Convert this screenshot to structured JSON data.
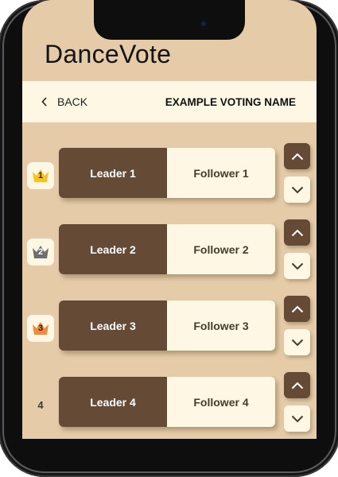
{
  "app": {
    "title": "DanceVote"
  },
  "header": {
    "back_label": "BACK",
    "voting_name": "EXAMPLE VOTING NAME"
  },
  "colors": {
    "background": "#e5cba7",
    "leader_bg": "#654a36",
    "follower_bg": "#fdf7e4",
    "gold": "#f6c22a",
    "silver": "#6e6e6e",
    "bronze": "#f08a3c"
  },
  "rows": [
    {
      "rank": "1",
      "medal": "gold-crown-icon",
      "leader": "Leader 1",
      "follower": "Follower 1"
    },
    {
      "rank": "2",
      "medal": "silver-crown-icon",
      "leader": "Leader 2",
      "follower": "Follower 2"
    },
    {
      "rank": "3",
      "medal": "bronze-crown-icon",
      "leader": "Leader 3",
      "follower": "Follower 3"
    },
    {
      "rank": "4",
      "medal": "",
      "leader": "Leader 4",
      "follower": "Follower 4"
    }
  ]
}
